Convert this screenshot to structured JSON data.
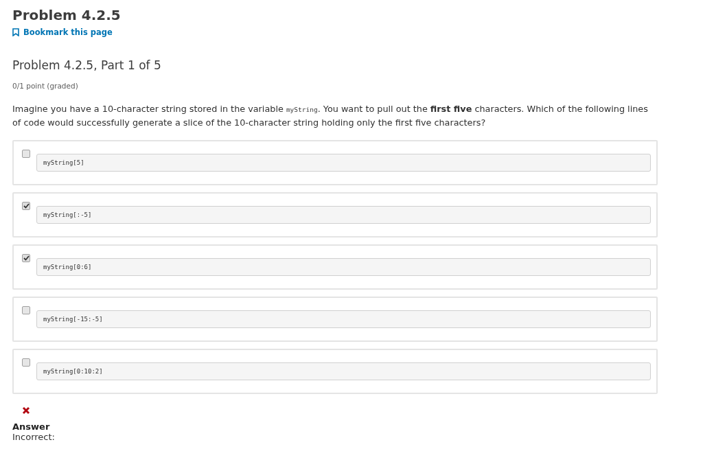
{
  "title": "Problem 4.2.5",
  "bookmark": "Bookmark this page",
  "part_title": "Problem 4.2.5, Part 1 of 5",
  "score": "0/1 point (graded)",
  "question": {
    "before": "Imagine you have a 10-character string stored in the variable ",
    "code": "myString",
    "after": ". You want to pull out the **first five** characters. Which of the following lines of code would successfully generate a slice of the 10-character string holding only the first five characters?"
  },
  "options": [
    {
      "code": "myString[5]",
      "checked": false
    },
    {
      "code": "myString[:-5]",
      "checked": true
    },
    {
      "code": "myString[0:6]",
      "checked": true
    },
    {
      "code": "myString[-15:-5]",
      "checked": false
    },
    {
      "code": "myString[0:10:2]",
      "checked": false
    }
  ],
  "result": {
    "correct": false,
    "heading": "Answer",
    "text": "Incorrect:"
  }
}
